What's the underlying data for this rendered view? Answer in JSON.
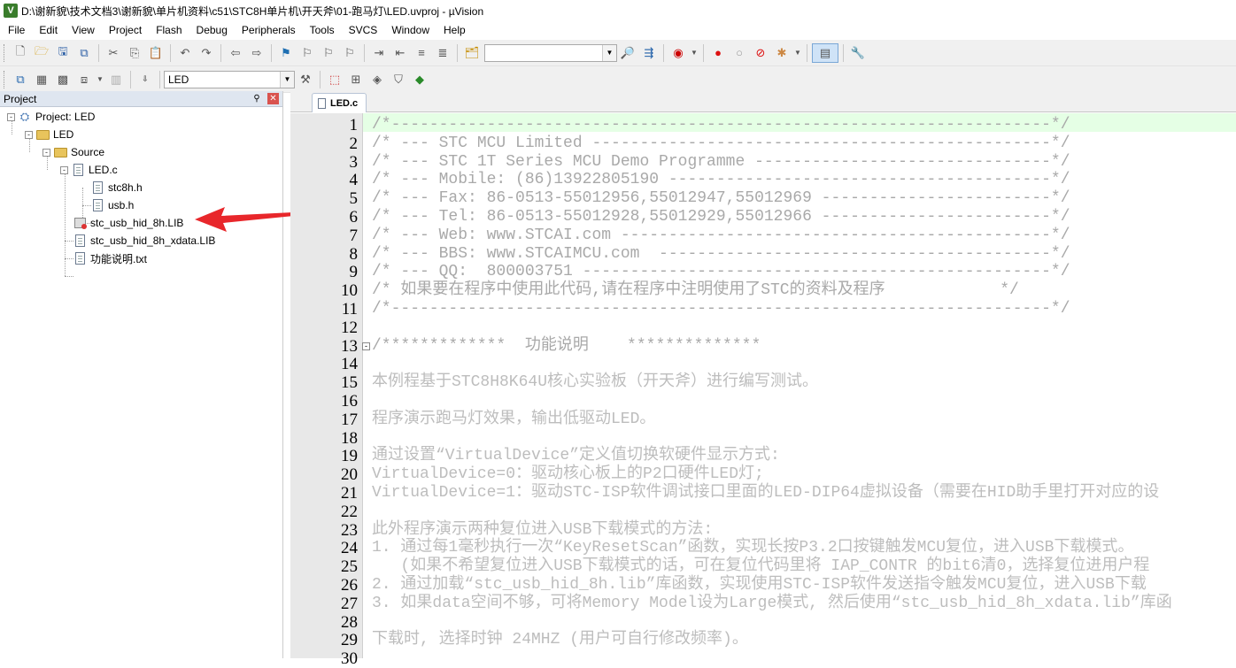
{
  "window": {
    "title": "D:\\谢新貌\\技术文档3\\谢新貌\\单片机资料\\c51\\STC8H单片机\\开天斧\\01-跑马灯\\LED.uvproj - µVision",
    "app_icon_letter": "V"
  },
  "menu": [
    "File",
    "Edit",
    "View",
    "Project",
    "Flash",
    "Debug",
    "Peripherals",
    "Tools",
    "SVCS",
    "Window",
    "Help"
  ],
  "toolbar2": {
    "target_select": "LED"
  },
  "project_panel": {
    "title": "Project",
    "tree": [
      {
        "label": "Project: LED",
        "depth": 0,
        "expander": "-",
        "icon": "project-icon"
      },
      {
        "label": "LED",
        "depth": 1,
        "expander": "-",
        "icon": "target-folder-icon"
      },
      {
        "label": "Source",
        "depth": 2,
        "expander": "-",
        "icon": "folder-icon"
      },
      {
        "label": "LED.c",
        "depth": 3,
        "expander": "-",
        "icon": "c-file-icon"
      },
      {
        "label": "stc8h.h",
        "depth": 4,
        "expander": "",
        "icon": "header-file-icon"
      },
      {
        "label": "usb.h",
        "depth": 4,
        "expander": "",
        "icon": "header-file-icon"
      },
      {
        "label": "stc_usb_hid_8h.LIB",
        "depth": 3,
        "expander": "",
        "icon": "lib-file-icon"
      },
      {
        "label": "stc_usb_hid_8h_xdata.LIB",
        "depth": 3,
        "expander": "",
        "icon": "lib-file-icon"
      },
      {
        "label": "功能说明.txt",
        "depth": 3,
        "expander": "",
        "icon": "text-file-icon"
      }
    ]
  },
  "editor": {
    "tab_label": "LED.c",
    "lines": [
      "/*---------------------------------------------------------------------*/",
      "/* --- STC MCU Limited ------------------------------------------------*/",
      "/* --- STC 1T Series MCU Demo Programme -------------------------------*/",
      "/* --- Mobile: (86)13922805190 ----------------------------------------*/",
      "/* --- Fax: 86-0513-55012956,55012947,55012969 ------------------------*/",
      "/* --- Tel: 86-0513-55012928,55012929,55012966 ------------------------*/",
      "/* --- Web: www.STCAI.com ---------------------------------------------*/",
      "/* --- BBS: www.STCAIMCU.com  -----------------------------------------*/",
      "/* --- QQ:  800003751 -------------------------------------------------*/",
      "/* 如果要在程序中使用此代码,请在程序中注明使用了STC的资料及程序            */",
      "/*---------------------------------------------------------------------*/",
      "",
      "/*************  功能说明    **************",
      "",
      "本例程基于STC8H8K64U核心实验板（开天斧）进行编写测试。",
      "",
      "程序演示跑马灯效果，输出低驱动LED。",
      "",
      "通过设置“VirtualDevice”定义值切换软硬件显示方式:",
      "VirtualDevice=0：驱动核心板上的P2口硬件LED灯;",
      "VirtualDevice=1：驱动STC-ISP软件调试接口里面的LED-DIP64虚拟设备（需要在HID助手里打开对应的设",
      "",
      "此外程序演示两种复位进入USB下载模式的方法:",
      "1. 通过每1毫秒执行一次“KeyResetScan”函数，实现长按P3.2口按键触发MCU复位，进入USB下载模式。",
      "   (如果不希望复位进入USB下载模式的话，可在复位代码里将 IAP_CONTR 的bit6清0，选择复位进用户程",
      "2. 通过加载“stc_usb_hid_8h.lib”库函数，实现使用STC-ISP软件发送指令触发MCU复位，进入USB下载",
      "3. 如果data空间不够，可将Memory Model设为Large模式, 然后使用“stc_usb_hid_8h_xdata.lib”库函",
      "",
      "下载时, 选择时钟 24MHZ (用户可自行修改频率)。",
      ""
    ],
    "line_numbers": [
      "1",
      "2",
      "3",
      "4",
      "5",
      "6",
      "7",
      "8",
      "9",
      "10",
      "11",
      "12",
      "13",
      "14",
      "15",
      "16",
      "17",
      "18",
      "19",
      "20",
      "21",
      "22",
      "23",
      "24",
      "25",
      "26",
      "27",
      "28",
      "29",
      "30"
    ],
    "fold_markers": [
      {
        "line": "13",
        "symbol": "-"
      }
    ]
  },
  "colors": {
    "current_line_highlight": "#e5ffe5",
    "annotation_arrow": "#e8272b"
  }
}
